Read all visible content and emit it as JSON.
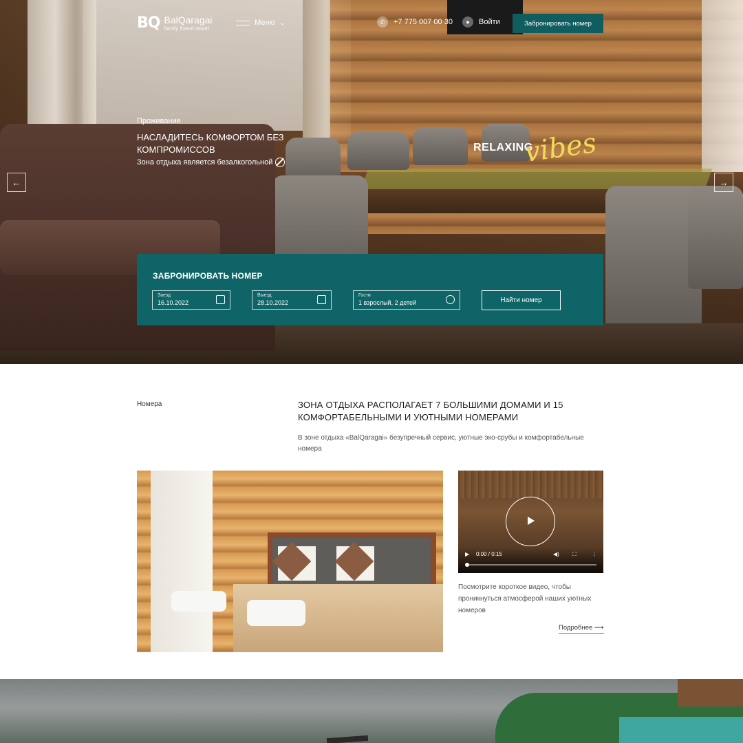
{
  "header": {
    "logo_mark": "BQ",
    "logo_name": "BalQaragai",
    "logo_sub": "family forest resort",
    "menu_label": "Меню",
    "phone": "+7 775 007 00 30",
    "login_label": "Войти",
    "book_label": "Забронировать номер"
  },
  "hero": {
    "eyebrow": "Проживание",
    "title": "Насладитесь комфортом без компромиссов",
    "desc": "Зона отдыха является безалкогольной",
    "relaxing": "RELAXING",
    "vibes": "vibes"
  },
  "booking": {
    "title": "Забронировать номер",
    "checkin_label": "Заезд",
    "checkin_value": "16.10.2022",
    "checkout_label": "Выезд",
    "checkout_value": "28.10.2022",
    "guests_label": "Гости",
    "guests_value": "1 взрослый, 2 детей",
    "find_label": "Найти номер"
  },
  "content": {
    "breadcrumb": "Номера",
    "title": "Зона отдыха располагает 7 большими домами и 15 комфортабельными и уютными номерами",
    "desc": "В зоне отдыха «BalQaragai» безупречный сервис, уютные эко-срубы и комфортабельные номера",
    "video_time": "0:00 / 0:15",
    "video_text": "Посмотрите короткое видео, чтобы проникнуться атмосферой наших уютных номеров",
    "more_label": "Подробнее ⟶"
  },
  "colors": {
    "accent": "#0e6466",
    "highlight": "#f1da5a"
  },
  "icons": [
    "menu-lines-icon",
    "phone-icon",
    "user-icon",
    "calendar-icon",
    "guests-icon",
    "arrow-left-icon",
    "arrow-right-icon",
    "play-icon",
    "no-alcohol-icon"
  ]
}
